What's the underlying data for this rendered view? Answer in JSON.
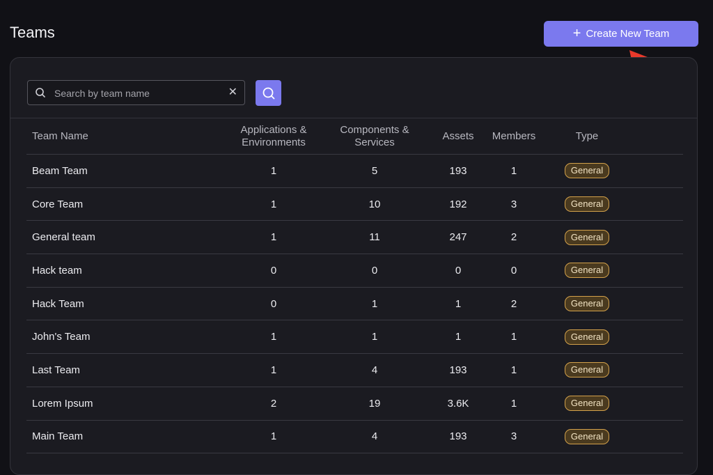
{
  "page": {
    "title": "Teams"
  },
  "actions": {
    "create_label": "Create New Team"
  },
  "search": {
    "placeholder": "Search by team name",
    "value": "",
    "clear": "✕"
  },
  "table": {
    "columns": {
      "name": "Team Name",
      "apps_line1": "Applications &",
      "apps_line2": "Environments",
      "comp_line1": "Components &",
      "comp_line2": "Services",
      "assets": "Assets",
      "members": "Members",
      "type": "Type"
    },
    "rows": [
      {
        "name": "Beam Team",
        "apps": "1",
        "components": "5",
        "assets": "193",
        "members": "1",
        "type": "General"
      },
      {
        "name": "Core Team",
        "apps": "1",
        "components": "10",
        "assets": "192",
        "members": "3",
        "type": "General"
      },
      {
        "name": "General team",
        "apps": "1",
        "components": "11",
        "assets": "247",
        "members": "2",
        "type": "General"
      },
      {
        "name": "Hack team",
        "apps": "0",
        "components": "0",
        "assets": "0",
        "members": "0",
        "type": "General"
      },
      {
        "name": "Hack Team",
        "apps": "0",
        "components": "1",
        "assets": "1",
        "members": "2",
        "type": "General"
      },
      {
        "name": "John's Team",
        "apps": "1",
        "components": "1",
        "assets": "1",
        "members": "1",
        "type": "General"
      },
      {
        "name": "Last Team",
        "apps": "1",
        "components": "4",
        "assets": "193",
        "members": "1",
        "type": "General"
      },
      {
        "name": "Lorem Ipsum",
        "apps": "2",
        "components": "19",
        "assets": "3.6K",
        "members": "1",
        "type": "General"
      },
      {
        "name": "Main Team",
        "apps": "1",
        "components": "4",
        "assets": "193",
        "members": "3",
        "type": "General"
      }
    ]
  },
  "colors": {
    "accent": "#7b79ee",
    "badge_border": "#d4a24b",
    "annotation_arrow": "#e8392b"
  },
  "icons": {
    "search": "search-icon",
    "plus": "plus-icon",
    "clear": "close-icon"
  }
}
